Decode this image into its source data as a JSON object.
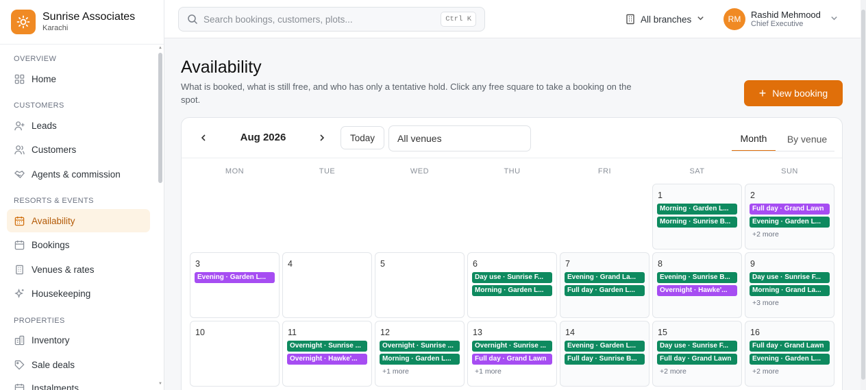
{
  "brand": {
    "name": "Sunrise Associates",
    "location": "Karachi",
    "logo_icon": "sun-icon",
    "color": "#f08a24"
  },
  "sidebar": {
    "sections": [
      {
        "label": "OVERVIEW",
        "items": [
          {
            "label": "Home",
            "icon": "home-grid-icon"
          }
        ]
      },
      {
        "label": "CUSTOMERS",
        "items": [
          {
            "label": "Leads",
            "icon": "user-plus-icon"
          },
          {
            "label": "Customers",
            "icon": "users-icon"
          },
          {
            "label": "Agents & commission",
            "icon": "handshake-icon"
          }
        ]
      },
      {
        "label": "RESORTS & EVENTS",
        "items": [
          {
            "label": "Availability",
            "icon": "calendar-icon",
            "active": true
          },
          {
            "label": "Bookings",
            "icon": "calendar-grid-icon"
          },
          {
            "label": "Venues & rates",
            "icon": "building-icon"
          },
          {
            "label": "Housekeeping",
            "icon": "sparkle-icon"
          }
        ]
      },
      {
        "label": "PROPERTIES",
        "items": [
          {
            "label": "Inventory",
            "icon": "buildings-icon"
          },
          {
            "label": "Sale deals",
            "icon": "tag-icon"
          },
          {
            "label": "Instalments",
            "icon": "calendar-money-icon"
          }
        ]
      }
    ]
  },
  "topbar": {
    "search_placeholder": "Search bookings, customers, plots...",
    "search_shortcut": "Ctrl K",
    "branch": "All branches",
    "user": {
      "initials": "RM",
      "name": "Rashid Mehmood",
      "role": "Chief Executive"
    }
  },
  "page": {
    "title": "Availability",
    "subtitle": "What is booked, what is still free, and who has only a tentative hold. Click any free square to take a booking on the spot.",
    "new_button": "New booking"
  },
  "calendar": {
    "month": "Aug 2026",
    "today_label": "Today",
    "venue_filter": "All venues",
    "views": [
      "Month",
      "By venue"
    ],
    "active_view": "Month",
    "weekdays": [
      "MON",
      "TUE",
      "WED",
      "THU",
      "FRI",
      "SAT",
      "SUN"
    ],
    "colors": {
      "confirmed": "#0e8a5f",
      "tentative": "#a64df2",
      "accent": "#e06f0a"
    },
    "weeks": [
      [
        null,
        null,
        null,
        null,
        null,
        {
          "day": "1",
          "events": [
            {
              "text": "Morning · Garden L...",
              "status": "confirmed"
            },
            {
              "text": "Morning · Sunrise B...",
              "status": "confirmed"
            }
          ],
          "more": ""
        },
        {
          "day": "2",
          "events": [
            {
              "text": "Full day · Grand Lawn",
              "status": "tentative"
            },
            {
              "text": "Evening · Garden L...",
              "status": "confirmed"
            }
          ],
          "more": "+2 more"
        }
      ],
      [
        {
          "day": "3",
          "events": [
            {
              "text": "Evening · Garden L...",
              "status": "tentative"
            }
          ],
          "more": ""
        },
        {
          "day": "4",
          "events": [],
          "more": ""
        },
        {
          "day": "5",
          "events": [],
          "more": ""
        },
        {
          "day": "6",
          "events": [
            {
              "text": "Day use · Sunrise F...",
              "status": "confirmed"
            },
            {
              "text": "Morning · Garden L...",
              "status": "confirmed"
            }
          ],
          "more": ""
        },
        {
          "day": "7",
          "events": [
            {
              "text": "Evening · Grand La...",
              "status": "confirmed"
            },
            {
              "text": "Full day · Garden L...",
              "status": "confirmed"
            }
          ],
          "more": ""
        },
        {
          "day": "8",
          "events": [
            {
              "text": "Evening · Sunrise B...",
              "status": "confirmed"
            },
            {
              "text": "Overnight · Hawke'...",
              "status": "tentative"
            }
          ],
          "more": ""
        },
        {
          "day": "9",
          "events": [
            {
              "text": "Day use · Sunrise F...",
              "status": "confirmed"
            },
            {
              "text": "Morning · Grand La...",
              "status": "confirmed"
            }
          ],
          "more": "+3 more"
        }
      ],
      [
        {
          "day": "10",
          "events": [],
          "more": ""
        },
        {
          "day": "11",
          "events": [
            {
              "text": "Overnight · Sunrise ...",
              "status": "confirmed"
            },
            {
              "text": "Overnight · Hawke'...",
              "status": "tentative"
            }
          ],
          "more": ""
        },
        {
          "day": "12",
          "events": [
            {
              "text": "Overnight · Sunrise ...",
              "status": "confirmed"
            },
            {
              "text": "Morning · Garden L...",
              "status": "confirmed"
            }
          ],
          "more": "+1 more"
        },
        {
          "day": "13",
          "events": [
            {
              "text": "Overnight · Sunrise ...",
              "status": "confirmed"
            },
            {
              "text": "Full day · Grand Lawn",
              "status": "tentative"
            }
          ],
          "more": "+1 more"
        },
        {
          "day": "14",
          "events": [
            {
              "text": "Evening · Garden L...",
              "status": "confirmed"
            },
            {
              "text": "Full day · Sunrise B...",
              "status": "confirmed"
            }
          ],
          "more": ""
        },
        {
          "day": "15",
          "events": [
            {
              "text": "Day use · Sunrise F...",
              "status": "confirmed"
            },
            {
              "text": "Full day · Grand Lawn",
              "status": "confirmed"
            }
          ],
          "more": "+2 more"
        },
        {
          "day": "16",
          "events": [
            {
              "text": "Full day · Grand Lawn",
              "status": "confirmed"
            },
            {
              "text": "Evening · Garden L...",
              "status": "confirmed"
            }
          ],
          "more": "+2 more"
        }
      ]
    ]
  }
}
